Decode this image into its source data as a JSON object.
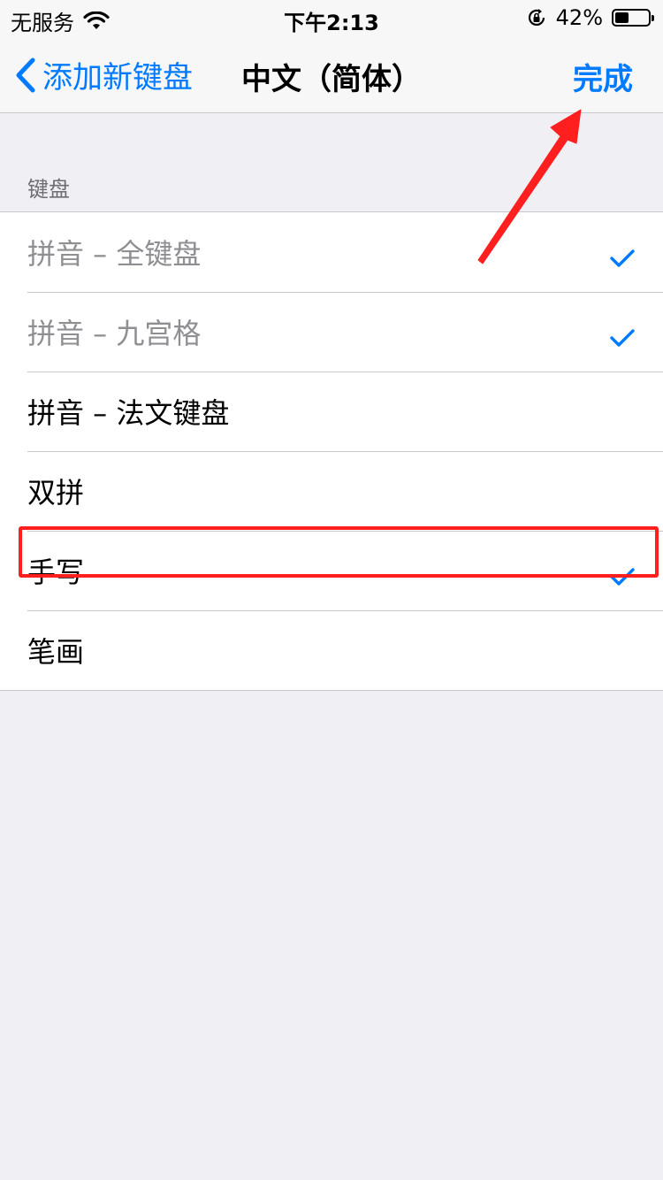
{
  "status_bar": {
    "carrier": "无服务",
    "time": "下午2:13",
    "battery_percent": "42%",
    "battery_level": 0.42
  },
  "nav": {
    "back_label": "添加新键盘",
    "title": "中文（简体）",
    "done_label": "完成"
  },
  "section": {
    "header": "键盘"
  },
  "items": [
    {
      "label": "拼音 – 全键盘",
      "checked": true,
      "disabled": true
    },
    {
      "label": "拼音 – 九宫格",
      "checked": true,
      "disabled": true
    },
    {
      "label": "拼音 – 法文键盘",
      "checked": false,
      "disabled": false
    },
    {
      "label": "双拼",
      "checked": false,
      "disabled": false
    },
    {
      "label": "手写",
      "checked": true,
      "disabled": false
    },
    {
      "label": "笔画",
      "checked": false,
      "disabled": false
    }
  ],
  "colors": {
    "accent": "#007aff",
    "annotation": "#ff1f1f",
    "disabled_text": "#8e8e93"
  },
  "icons": {
    "wifi": "wifi-icon",
    "rotation_lock": "rotation-lock-icon",
    "battery": "battery-icon",
    "back": "chevron-left-icon",
    "check": "checkmark-icon"
  }
}
